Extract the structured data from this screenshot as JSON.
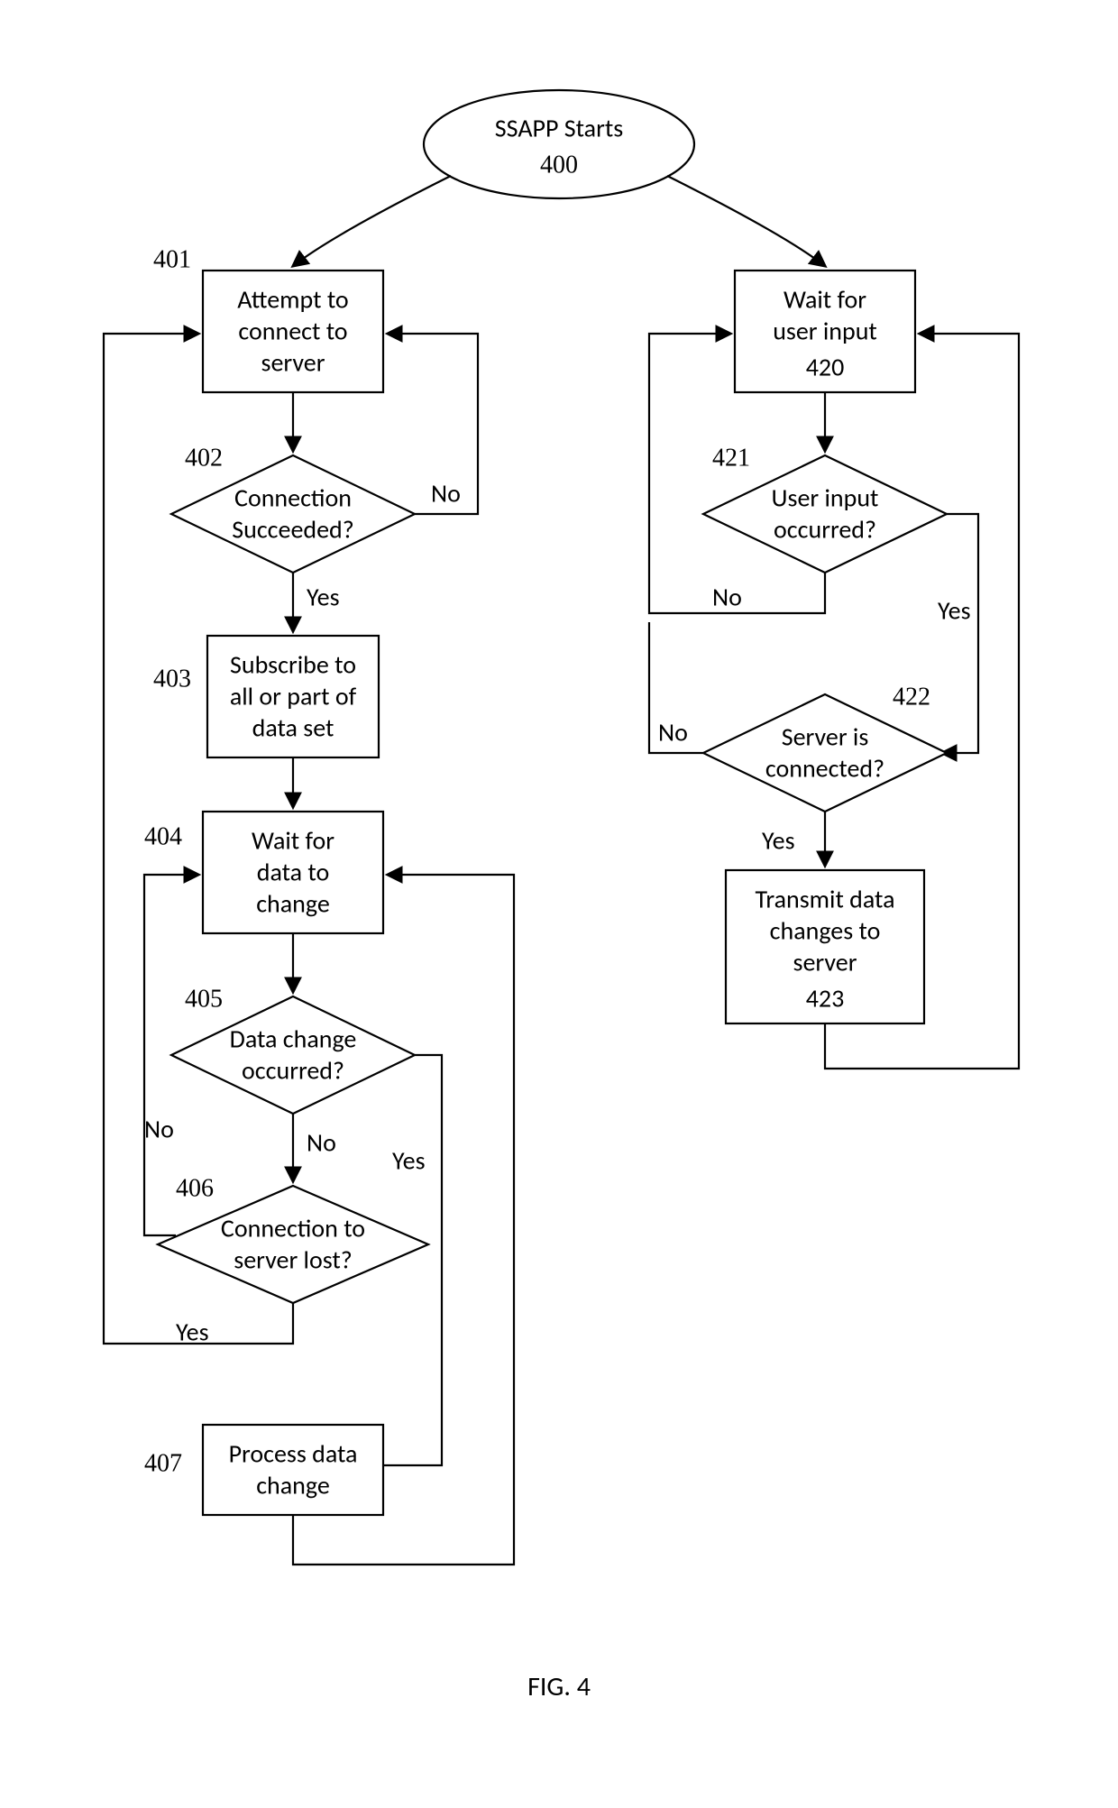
{
  "figure_label": "FIG. 4",
  "nodes": {
    "start": {
      "ref": "400",
      "lines": [
        "SSAPP Starts"
      ]
    },
    "n401": {
      "ref": "401",
      "lines": [
        "Attempt to",
        "connect to",
        "server"
      ]
    },
    "n402": {
      "ref": "402",
      "lines": [
        "Connection",
        "Succeeded?"
      ]
    },
    "n403": {
      "ref": "403",
      "lines": [
        "Subscribe to",
        "all or part of",
        "data set"
      ]
    },
    "n404": {
      "ref": "404",
      "lines": [
        "Wait for",
        "data to",
        "change"
      ]
    },
    "n405": {
      "ref": "405",
      "lines": [
        "Data change",
        "occurred?"
      ]
    },
    "n406": {
      "ref": "406",
      "lines": [
        "Connection to",
        "server lost?"
      ]
    },
    "n407": {
      "ref": "407",
      "lines": [
        "Process data",
        "change"
      ]
    },
    "n420": {
      "ref": "420",
      "lines": [
        "Wait for",
        "user input"
      ]
    },
    "n421": {
      "ref": "421",
      "lines": [
        "User input",
        "occurred?"
      ]
    },
    "n422": {
      "ref": "422",
      "lines": [
        "Server is",
        "connected?"
      ]
    },
    "n423": {
      "ref": "423",
      "lines": [
        "Transmit data",
        "changes to",
        "server"
      ]
    }
  },
  "labels": {
    "yes": "Yes",
    "no": "No"
  }
}
